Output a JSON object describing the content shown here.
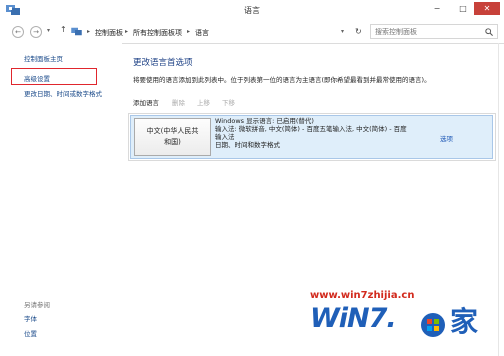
{
  "window": {
    "title": "语言",
    "minimize": "−",
    "maximize": "□",
    "close": "✕"
  },
  "address": {
    "back_icon": "back-arrow-icon",
    "forward_icon": "forward-arrow-icon",
    "up_icon": "up-arrow-icon",
    "crumbs": [
      "控制面板",
      "所有控制面板项",
      "语言"
    ],
    "refresh_icon": "refresh-icon",
    "search_placeholder": "搜索控制面板"
  },
  "sidebar": {
    "links": [
      "控制面板主页",
      "高级设置",
      "更改日期、时间或数字格式"
    ],
    "see_also_heading": "另请参阅",
    "see_also": [
      "字体",
      "位置"
    ]
  },
  "main": {
    "title": "更改语言首选项",
    "description": "将要使用的语言添加到此列表中。位于列表第一位的语言为主语言(即你希望最看到并最常使用的语言)。",
    "toolbar": [
      "添加语言",
      "删除",
      "上移",
      "下移"
    ],
    "language": {
      "name_line1": "中文(中华人民共",
      "name_line2": "和国)",
      "detail_line1": "Windows 显示语言: 已启用(替代)",
      "detail_line2": "输入法: 微软拼音, 中文(简体) - 百度五笔输入法, 中文(简体) - 百度",
      "detail_line3": "输入法",
      "detail_line4": "日期、时间和数字格式",
      "options": "选项"
    }
  },
  "watermark": {
    "url": "www.win7zhijia.cn",
    "logo": "WiN7.",
    "cjk": "家"
  },
  "colors": {
    "link": "#1a4a8a",
    "title": "#1b3f84",
    "highlight": "#e0262d",
    "selected_row": "#dfeefa"
  }
}
